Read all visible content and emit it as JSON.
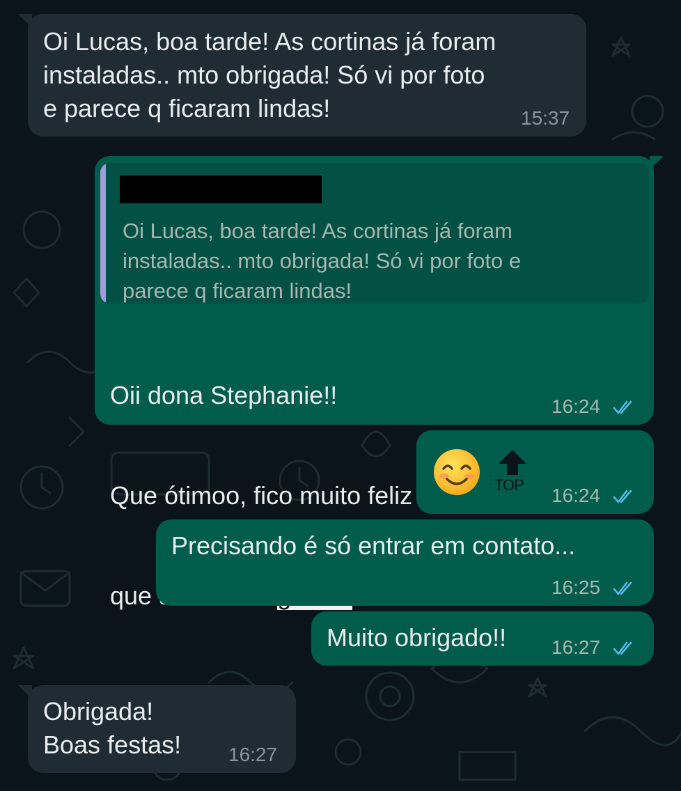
{
  "chat": {
    "messages": [
      {
        "direction": "incoming",
        "text": "Oi Lucas, boa tarde! As cortinas já foram\ninstaladas.. mto obrigada! Só vi por foto\ne parece q ficaram lindas!",
        "time": "15:37"
      },
      {
        "direction": "outgoing",
        "reply_to": {
          "author_redacted": true,
          "text": "Oi Lucas, boa tarde! As cortinas já foram\ninstaladas.. mto obrigada! Só vi por foto e\nparece q ficaram lindas!"
        },
        "text_line1": "Oii dona Stephanie!!",
        "text_line2": "Que ótimoo, fico muito feliz em saber",
        "text_line3_pre": "que a senhora ",
        "text_line3_highlight": "gostou",
        "text_line3_post": "!!",
        "time": "16:24",
        "status": "read"
      },
      {
        "direction": "outgoing",
        "emoji": "smiling-face-with-smiling-eyes",
        "sticker_label": "TOP",
        "time": "16:24",
        "status": "read"
      },
      {
        "direction": "outgoing",
        "text": "Precisando é só entrar em contato...",
        "time": "16:25",
        "status": "read"
      },
      {
        "direction": "outgoing",
        "text": "Muito obrigado!!",
        "time": "16:27",
        "status": "read"
      },
      {
        "direction": "incoming",
        "text": "Obrigada!\nBoas festas!",
        "time": "16:27"
      }
    ]
  },
  "colors": {
    "background": "#0b141a",
    "incoming_bubble": "#202c33",
    "outgoing_bubble": "#005c4b",
    "quote_background": "#025144",
    "quote_bar": "#a29bdc",
    "read_ticks": "#53bdeb"
  }
}
